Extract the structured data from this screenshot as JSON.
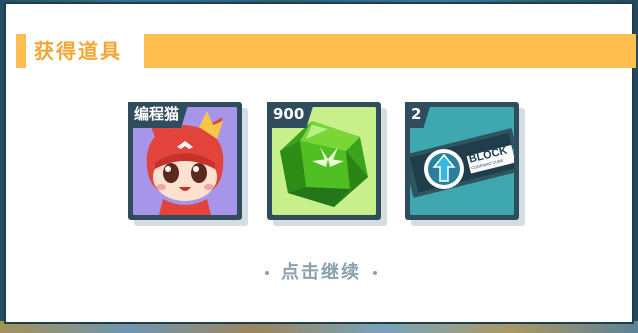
{
  "dialog": {
    "title": "获得道具",
    "continue_label": "点击继续"
  },
  "items": [
    {
      "name": "cat-avatar",
      "tag": "编程猫",
      "icon": "cat-mascot-icon"
    },
    {
      "name": "green-gem",
      "tag": "900",
      "icon": "green-gem-icon"
    },
    {
      "name": "block-ticket",
      "tag": "2",
      "icon": "block-ticket-icon",
      "ticket_text": "BLOCK",
      "ticket_subtext": "CODEMAO CUBE"
    }
  ],
  "colors": {
    "accent": "#ffbe4e",
    "title_text": "#f2a636",
    "frame": "#2f4d5c",
    "continue_text": "#8aa0ae"
  }
}
